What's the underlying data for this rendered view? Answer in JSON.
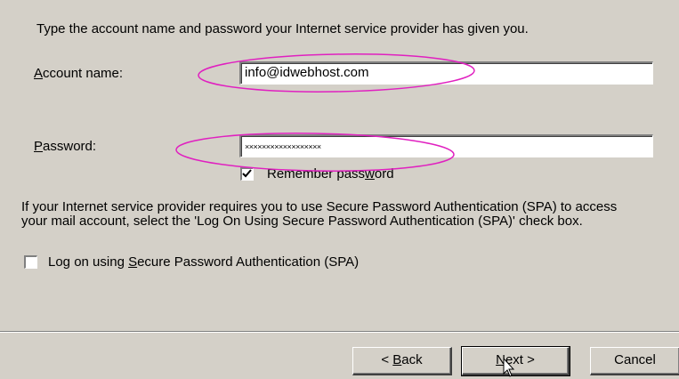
{
  "intro_text": "Type the account name and password your Internet service provider has given you.",
  "account": {
    "label_prefix": "",
    "label_hotkey": "A",
    "label_rest": "ccount name:",
    "value": "info@idwebhost.com"
  },
  "password": {
    "label_hotkey": "P",
    "label_rest": "assword:",
    "masked_value": "××××××××××××××××××"
  },
  "remember": {
    "label_before": "Remember pass",
    "label_hotkey": "w",
    "label_after": "ord",
    "checked": true
  },
  "spa_info": "If your Internet service provider requires you to use Secure Password Authentication (SPA) to access your mail account, select the 'Log On Using Secure Password Authentication (SPA)' check box.",
  "spa": {
    "label_before": "Log on using ",
    "label_hotkey": "S",
    "label_after": "ecure Password Authentication (SPA)",
    "checked": false
  },
  "buttons": {
    "back_prefix": "< ",
    "back_hotkey": "B",
    "back_rest": "ack",
    "next_hotkey": "N",
    "next_rest": "ext >",
    "cancel": "Cancel"
  },
  "colors": {
    "dialog_bg": "#d4d0c8",
    "annotation": "#e020c0"
  }
}
